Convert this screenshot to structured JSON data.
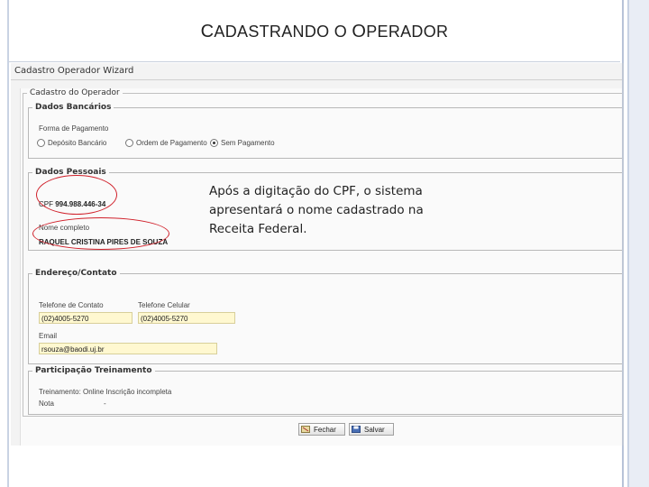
{
  "slide": {
    "title_first": "C",
    "title_rest1": "ADASTRANDO O ",
    "title_second": "O",
    "title_rest2": "PERADOR",
    "callout": "Após a digitação do CPF, o sistema apresentará o nome cadastrado na Receita Federal."
  },
  "wizard": {
    "title": "Cadastro Operador Wizard",
    "main_legend": "Cadastro do Operador",
    "bank": {
      "legend": "Dados Bancários",
      "payment_label": "Forma de Pagamento",
      "options": [
        "Depósito Bancário",
        "Ordem de Pagamento",
        "Sem Pagamento"
      ],
      "selected_index": 2
    },
    "personal": {
      "legend": "Dados Pessoais",
      "cpf_label": "CPF",
      "cpf_value": "994.988.446-34",
      "name_label": "Nome completo",
      "name_value": "RAQUEL CRISTINA PIRES DE SOUZA"
    },
    "contact": {
      "legend": "Endereço/Contato",
      "phone_label": "Telefone de Contato",
      "phone_value": "(02)4005-5270",
      "mobile_label": "Telefone Celular",
      "mobile_value": "(02)4005-5270",
      "email_label": "Email",
      "email_value": "rsouza@baodi.uj.br"
    },
    "training": {
      "legend": "Participação Treinamento",
      "training_label": "Treinamento: Online Inscrição incompleta",
      "grade_label": "Nota",
      "grade_value": "-"
    },
    "buttons": {
      "close": "Fechar",
      "save": "Salvar"
    }
  },
  "colors": {
    "highlight_oval": "#d0202a",
    "input_bg": "#fff8d0"
  }
}
